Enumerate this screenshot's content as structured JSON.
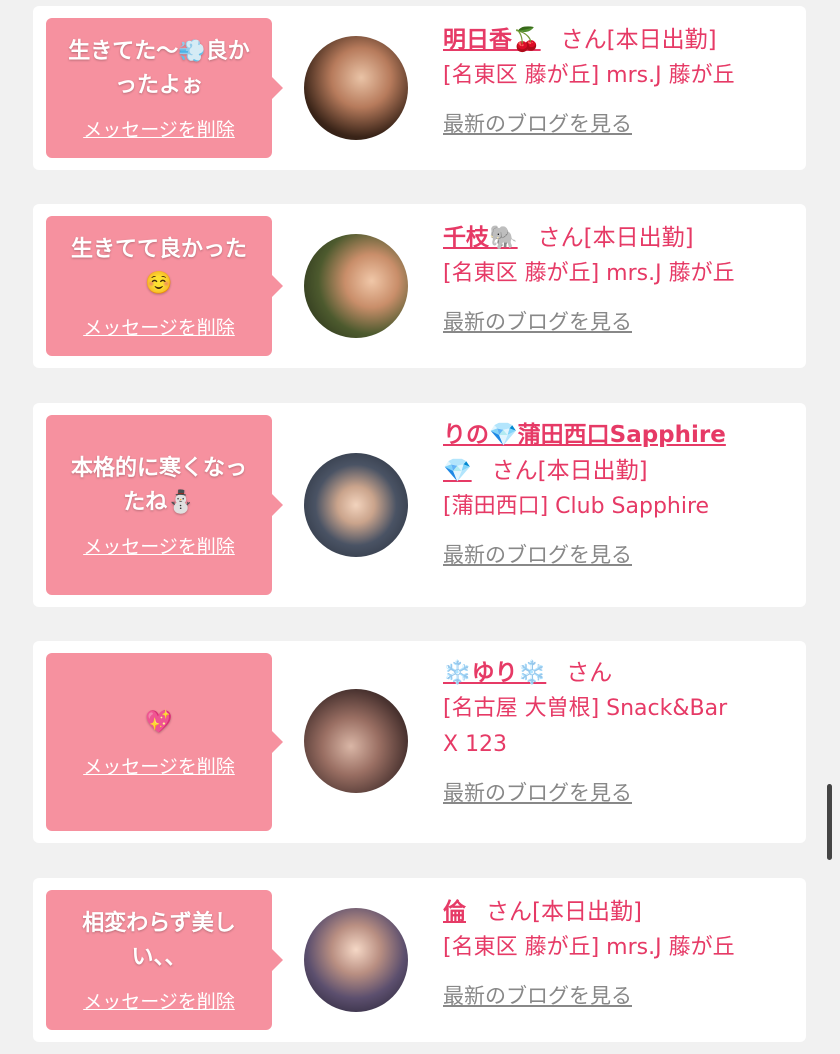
{
  "common": {
    "delete_label": "メッセージを削除",
    "blog_label": "最新のブログを見る",
    "san": "さん"
  },
  "cards": [
    {
      "message": "生きてた〜💨良か\nったよぉ",
      "name": "明日香🍒",
      "status": "[本日出勤]",
      "shop": "[名東区 藤が丘] mrs.J 藤が丘"
    },
    {
      "message": "生きてて良かった\n☺️",
      "name": "千枝🐘",
      "status": "[本日出勤]",
      "shop": "[名東区 藤が丘] mrs.J 藤が丘"
    },
    {
      "message": "本格的に寒くなっ\nたね⛄",
      "name_line1": "りの💎蒲田西口Sapphire",
      "name_line2": "💎",
      "status": "[本日出勤]",
      "shop": "[蒲田西口] Club Sapphire"
    },
    {
      "message": "💖",
      "name": "❄️ゆり❄️",
      "status": "",
      "shop_line1": "[名古屋 大曽根] Snack&Bar",
      "shop_line2": "X 123"
    },
    {
      "message": "相変わらず美し\nい、、",
      "name": "倫",
      "status": "[本日出勤]",
      "shop": "[名東区 藤が丘] mrs.J 藤が丘"
    }
  ]
}
